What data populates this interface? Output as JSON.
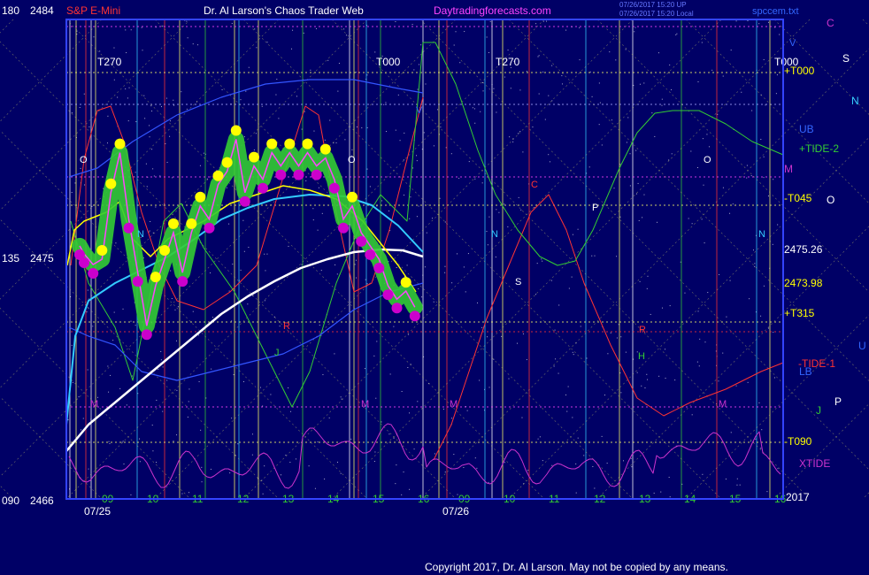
{
  "header": {
    "instrument": "S&P E-Mini",
    "title": "Dr. Al Larson's Chaos Trader Web",
    "site": "Daytradingforecasts.com",
    "stamp1": "07/26/2017 15:20 UP",
    "stamp2": "07/26/2017 15:20 Local",
    "file": "spccem.txt"
  },
  "footer": {
    "copyright": "Copyright 2017, Dr. Al Larson. May not be copied by any means."
  },
  "chart_data": {
    "type": "line",
    "ylim": [
      2466,
      2484
    ],
    "ytick_labels": [
      {
        "angle": "180",
        "price": "2484"
      },
      {
        "angle": "135",
        "price": "2475"
      },
      {
        "angle": "090",
        "price": "2466"
      }
    ],
    "x_hour_labels_day1": [
      "09",
      "10",
      "11",
      "12",
      "13",
      "14",
      "15",
      "16"
    ],
    "x_hour_labels_day2": [
      "09",
      "10",
      "11",
      "12",
      "13",
      "14",
      "15",
      "16"
    ],
    "date_labels": [
      "07/25",
      "07/26"
    ],
    "year_label": "2017",
    "right_labels": [
      {
        "text": "+T000",
        "color": "#ffff00"
      },
      {
        "text": "UB",
        "color": "#3366ff"
      },
      {
        "text": "+TIDE-2",
        "color": "#33cc33"
      },
      {
        "text": "M",
        "color": "#cc33cc"
      },
      {
        "text": "-T045",
        "color": "#ffff00"
      },
      {
        "text": "2475.26",
        "color": "#ffffff"
      },
      {
        "text": "2473.98",
        "color": "#ffff00"
      },
      {
        "text": "+T315",
        "color": "#ffff00"
      },
      {
        "text": "-TIDE-1",
        "color": "#ff3333"
      },
      {
        "text": "LB",
        "color": "#3366ff"
      },
      {
        "text": "-T090",
        "color": "#ffff00"
      },
      {
        "text": "XTIDE",
        "color": "#cc33cc"
      }
    ],
    "far_right_letters": [
      {
        "text": "C",
        "color": "#cc33cc"
      },
      {
        "text": "S",
        "color": "#ffffff"
      },
      {
        "text": "N",
        "color": "#33ccff"
      },
      {
        "text": "O",
        "color": "#ffffff"
      },
      {
        "text": "U",
        "color": "#3366ff"
      },
      {
        "text": "J",
        "color": "#33cc33"
      },
      {
        "text": "P",
        "color": "#ffffff"
      }
    ],
    "top_markers": [
      "T270",
      "T000",
      "T270",
      "T000"
    ],
    "planet_markers": [
      {
        "text": "O",
        "color": "#ffffff"
      },
      {
        "text": "O",
        "color": "#ffffff"
      },
      {
        "text": "O",
        "color": "#ffffff"
      },
      {
        "text": "N",
        "color": "#33ccff"
      },
      {
        "text": "N",
        "color": "#33ccff"
      },
      {
        "text": "N",
        "color": "#33ccff"
      },
      {
        "text": "S",
        "color": "#ffffff"
      },
      {
        "text": "P",
        "color": "#ffffff"
      },
      {
        "text": "H",
        "color": "#33cc33"
      },
      {
        "text": "M",
        "color": "#cc33cc"
      },
      {
        "text": "M",
        "color": "#cc33cc"
      },
      {
        "text": "M",
        "color": "#cc33cc"
      },
      {
        "text": "M",
        "color": "#cc33cc"
      },
      {
        "text": "C",
        "color": "#ff3333"
      },
      {
        "text": "R",
        "color": "#ff3333"
      },
      {
        "text": "R",
        "color": "#ff3333"
      },
      {
        "text": "V",
        "color": "#3366ff"
      },
      {
        "text": "V",
        "color": "#3366ff"
      },
      {
        "text": "J",
        "color": "#33cc33"
      }
    ],
    "price_series": {
      "name": "",
      "times_hours": [
        8.5,
        8.6,
        8.8,
        9.0,
        9.2,
        9.4,
        9.6,
        9.8,
        10.0,
        10.2,
        10.4,
        10.6,
        10.8,
        11.0,
        11.2,
        11.4,
        11.6,
        11.8,
        12.0,
        12.2,
        12.4,
        12.6,
        12.8,
        13.0,
        13.2,
        13.4,
        13.6,
        13.8,
        14.0,
        14.2,
        14.4,
        14.6,
        14.8,
        15.0,
        15.2,
        15.4,
        15.6,
        15.8,
        16.0
      ],
      "values": [
        2475.5,
        2475.2,
        2474.8,
        2475.0,
        2477.5,
        2479.0,
        2476.5,
        2474.5,
        2472.5,
        2474.0,
        2475.0,
        2476.0,
        2474.5,
        2476.0,
        2477.0,
        2476.5,
        2477.8,
        2478.3,
        2479.5,
        2477.5,
        2478.5,
        2478.0,
        2479.0,
        2478.5,
        2479.0,
        2478.5,
        2479.0,
        2478.5,
        2478.8,
        2478.0,
        2476.5,
        2477.0,
        2476.0,
        2475.5,
        2475.0,
        2474.0,
        2473.5,
        2473.8,
        2473.2
      ]
    }
  }
}
